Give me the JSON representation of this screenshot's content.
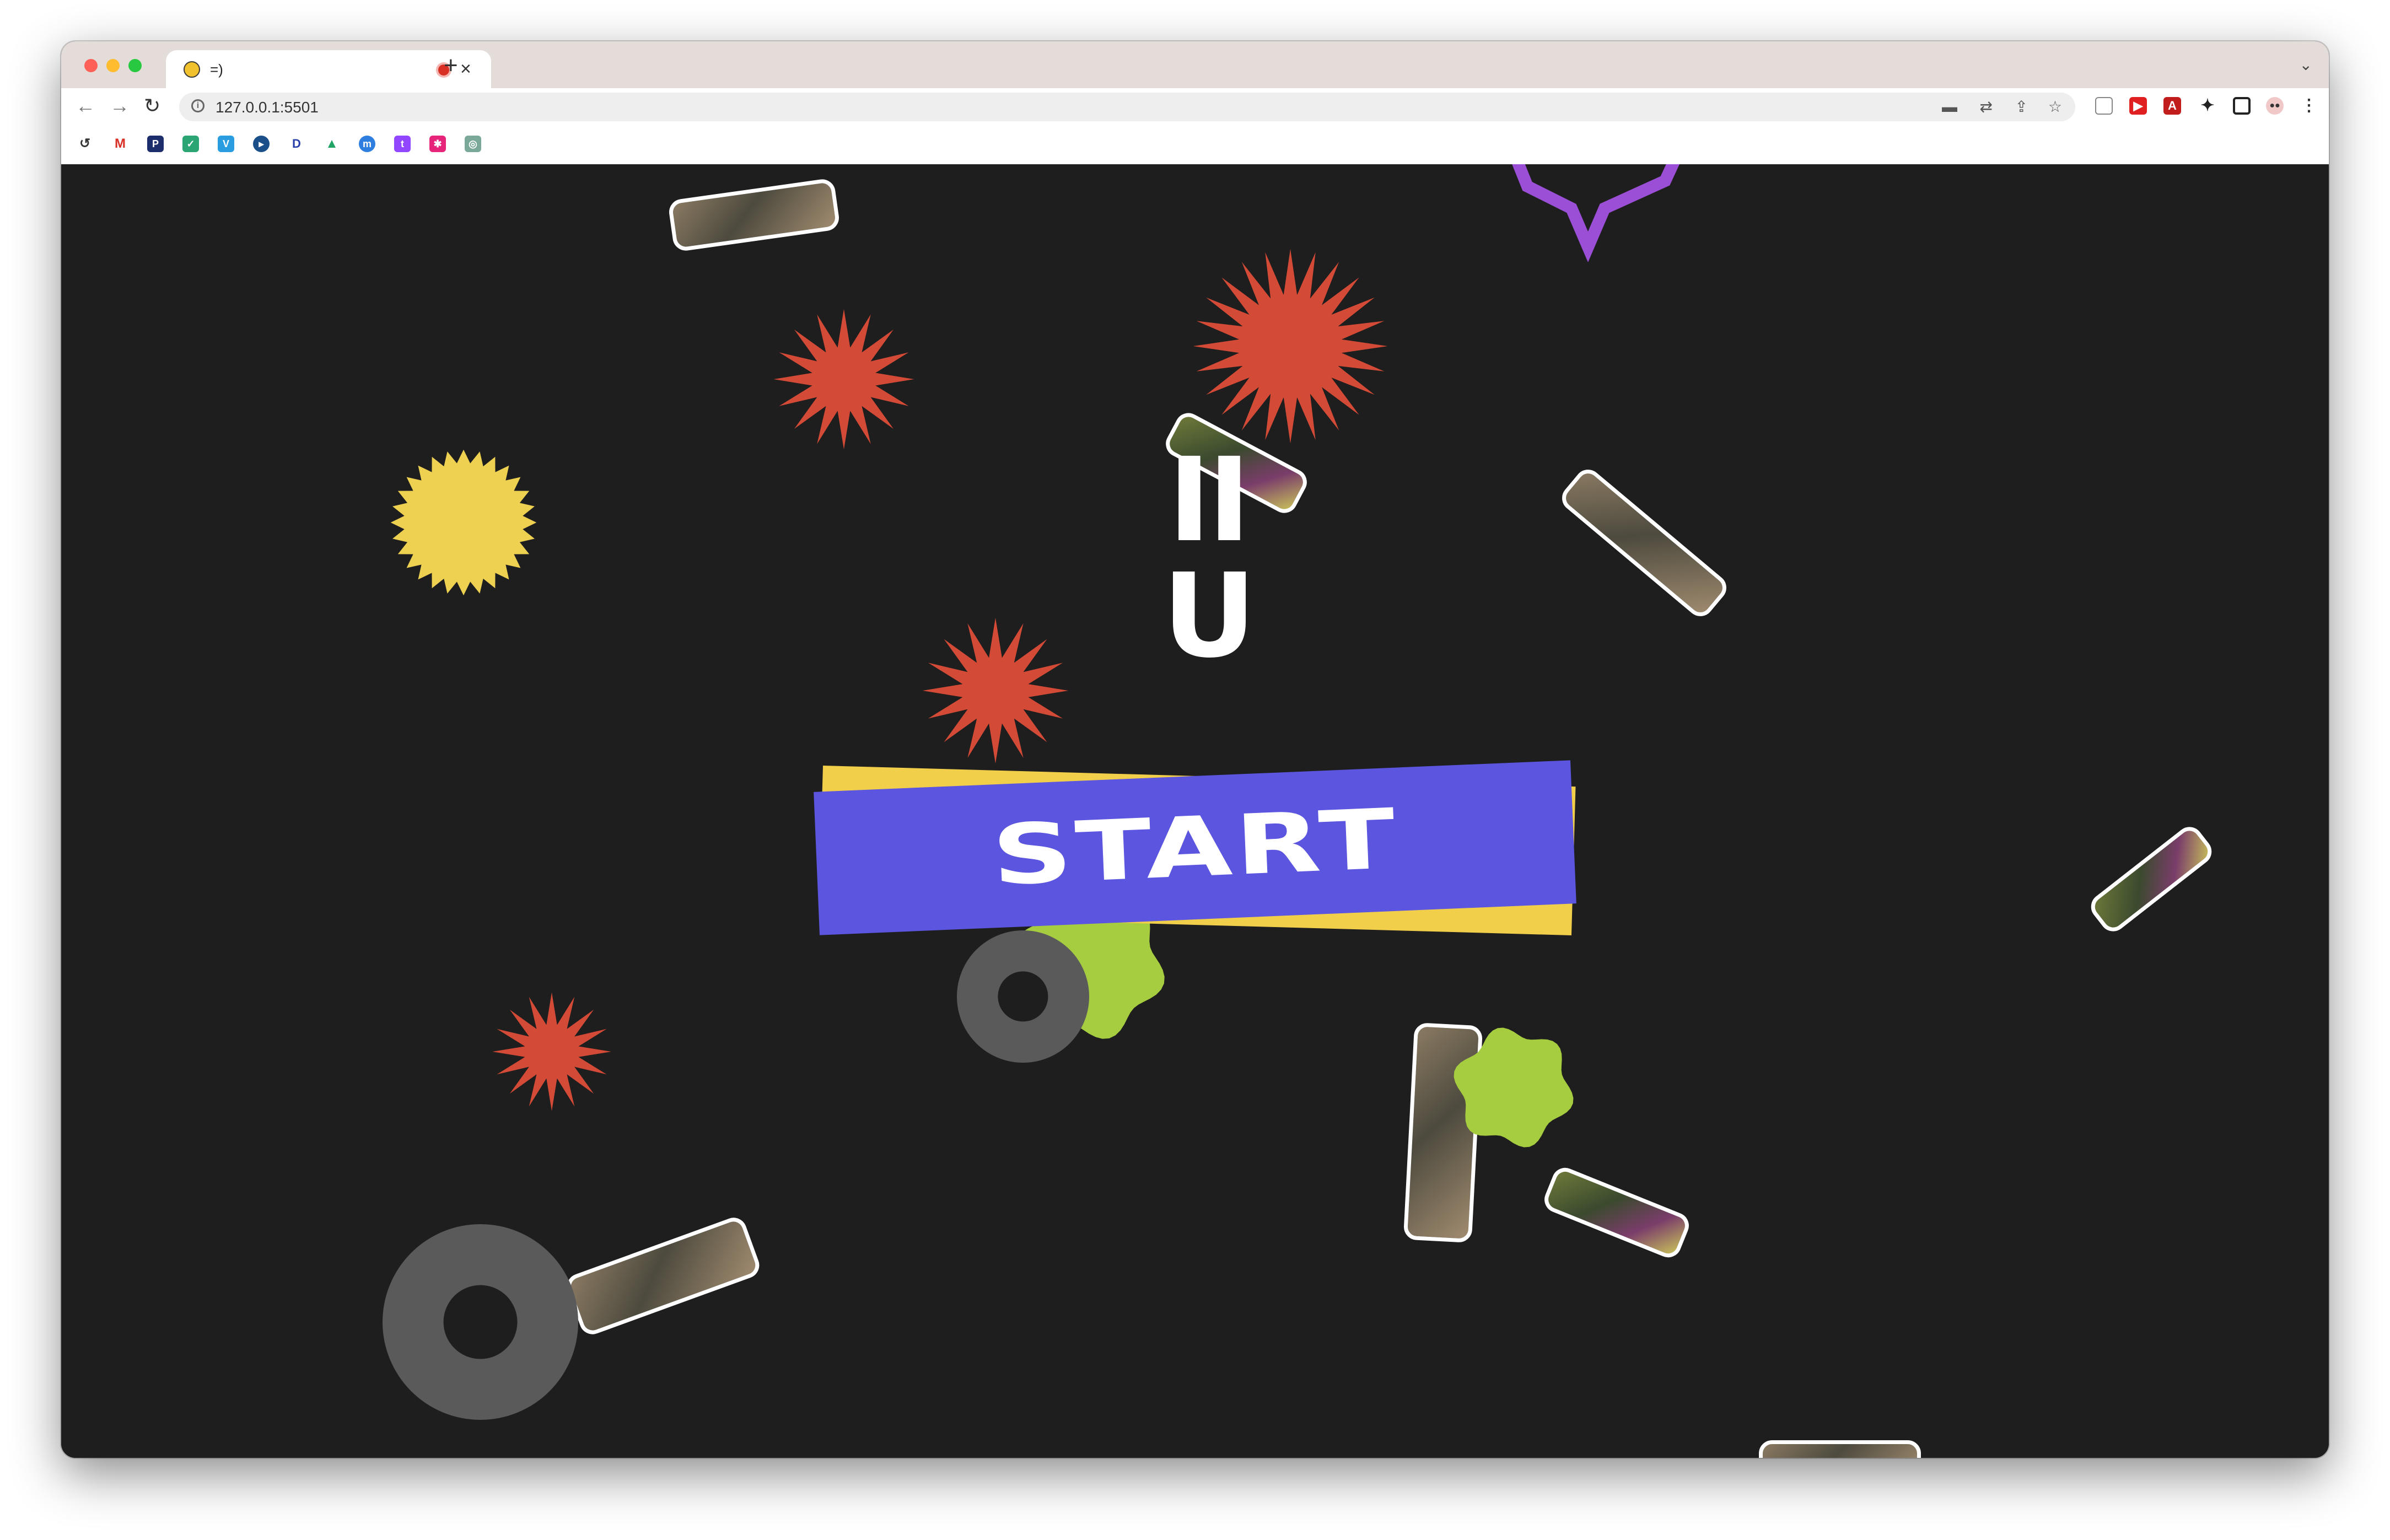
{
  "browser": {
    "tab": {
      "title": "=)"
    },
    "new_tab_label": "+",
    "close_label": "×",
    "url": "127.0.0.1:5501"
  },
  "page": {
    "title_line_1": "II",
    "title_line_2": "U",
    "start_label": "START"
  },
  "colors": {
    "background": "#1e1e1e",
    "starburst_red": "#d34a36",
    "starburst_yellow": "#efd152",
    "starburst_purple": "#9b4fd6",
    "blob_green": "#a6cc3f",
    "donut_gray": "#5a5a5a",
    "start_blue": "#5b55e0",
    "start_yellow": "#f2cf4a"
  }
}
